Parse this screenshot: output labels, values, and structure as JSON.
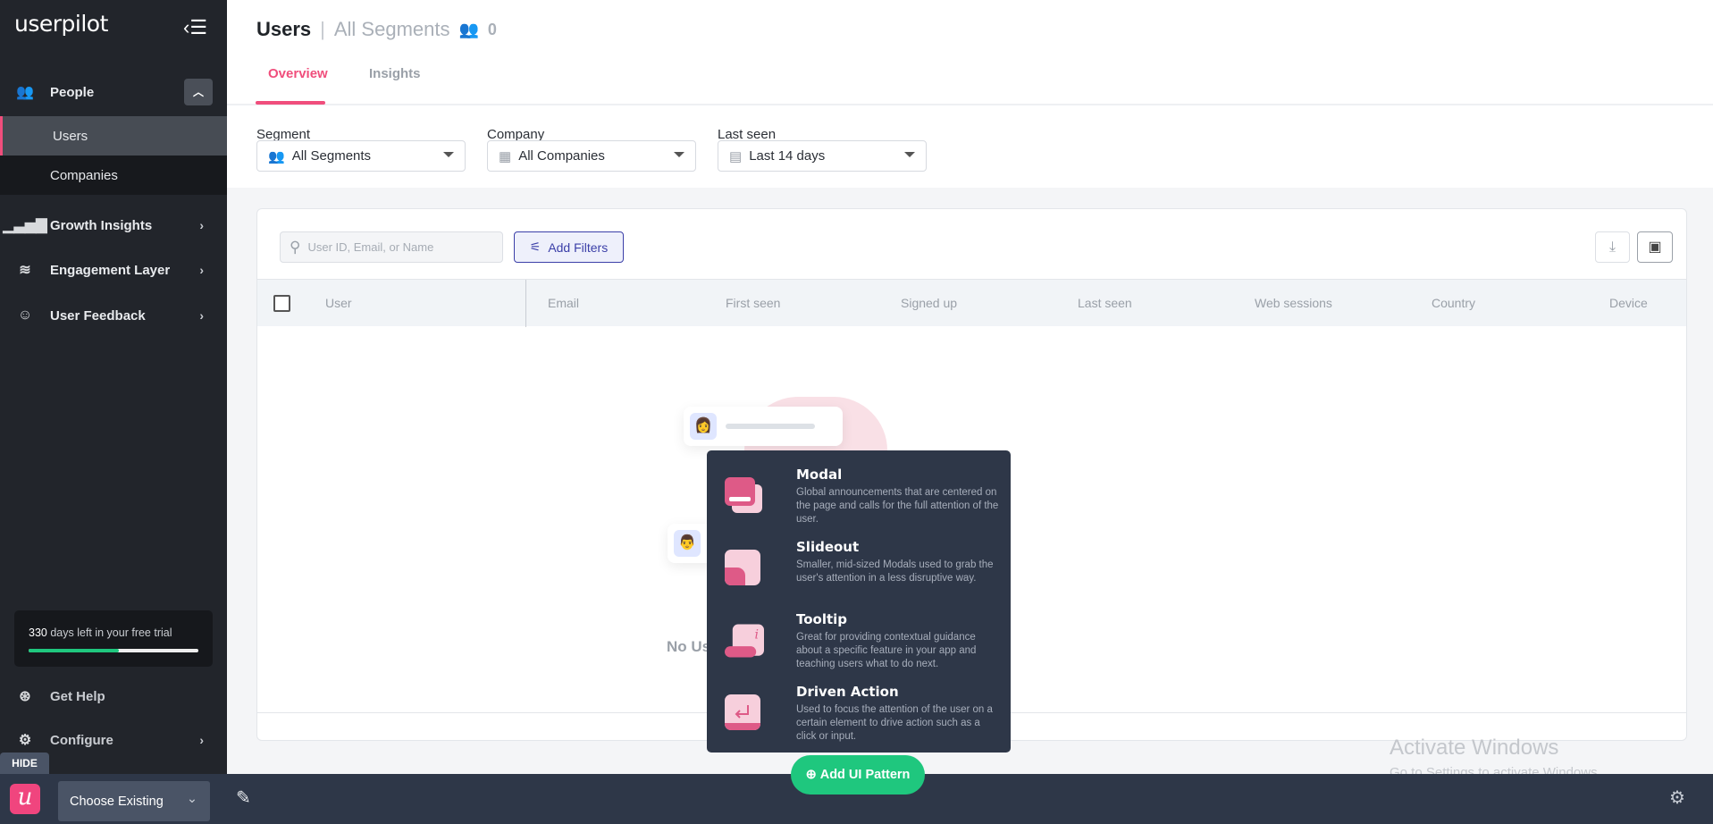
{
  "sidebar": {
    "logo": "userpilot",
    "collapse_icon": "collapse-menu-icon",
    "people": {
      "label": "People",
      "subitems": [
        {
          "label": "Users",
          "active": true
        },
        {
          "label": "Companies"
        }
      ]
    },
    "items": [
      {
        "label": "Growth Insights",
        "icon": "bar-chart-icon"
      },
      {
        "label": "Engagement Layer",
        "icon": "layers-icon"
      },
      {
        "label": "User Feedback",
        "icon": "smile-icon"
      }
    ],
    "trial": {
      "days": "330",
      "text": " days left in your free trial",
      "progress": 0.53
    },
    "get_help": "Get Help",
    "configure": "Configure"
  },
  "header": {
    "title": "Users",
    "separator": "|",
    "segment": "All Segments",
    "count": "0",
    "tabs": [
      {
        "label": "Overview",
        "active": true
      },
      {
        "label": "Insights"
      }
    ]
  },
  "filters": {
    "segment": {
      "label": "Segment",
      "value": "All Segments"
    },
    "company": {
      "label": "Company",
      "value": "All Companies"
    },
    "last_seen": {
      "label": "Last seen",
      "value": "Last 14 days"
    }
  },
  "table": {
    "search_placeholder": "User ID, Email, or Name",
    "add_filters": "Add Filters",
    "columns": [
      "User",
      "Email",
      "First seen",
      "Signed up",
      "Last seen",
      "Web sessions",
      "Country",
      "Device"
    ],
    "empty_text": "No Users"
  },
  "popup": {
    "items": [
      {
        "title": "Modal",
        "desc": "Global announcements that are centered on the page and calls for the full attention of the user."
      },
      {
        "title": "Slideout",
        "desc": "Smaller, mid-sized Modals used to grab the user's attention in a less disruptive way."
      },
      {
        "title": "Tooltip",
        "desc": "Great for providing contextual guidance about a specific feature in your app and teaching users what to do next."
      },
      {
        "title": "Driven Action",
        "desc": "Used to focus the attention of the user on a certain element to drive action such as a click or input."
      }
    ]
  },
  "toolbar": {
    "hide": "HIDE",
    "choose_existing": "Choose Existing",
    "add_ui_pattern": "Add UI Pattern",
    "brand_letter": "u"
  },
  "watermark": {
    "title": "Activate Windows",
    "subtitle": "Go to Settings to activate Windows."
  },
  "colors": {
    "accent": "#f04e7c",
    "green": "#1fc77e",
    "sidebar": "#22252b",
    "popup": "#2e3748",
    "filter_button": "#3b3fa8"
  }
}
